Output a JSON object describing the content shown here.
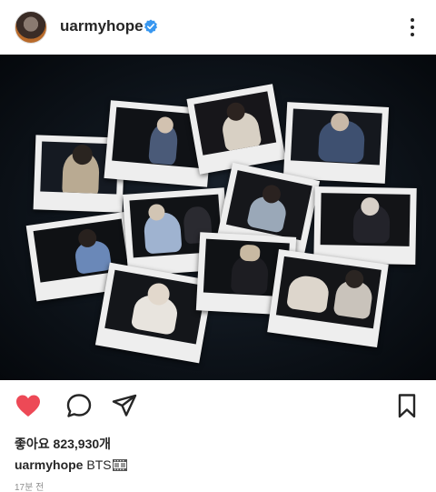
{
  "header": {
    "username": "uarmyhope",
    "avatar_alt": "profile avatar"
  },
  "colors": {
    "like_red": "#ed4956",
    "verified_blue": "#3897f0",
    "text": "#262626",
    "muted": "#8e8e8e"
  },
  "post": {
    "image_description_icon": "polaroid-photos-image",
    "likes_text": "좋아요 823,930개",
    "caption_user": "uarmyhope",
    "caption_text": "BTS",
    "caption_emoji": "film-frames-icon",
    "time_ago": "17분 전"
  },
  "actions": {
    "like_icon": "heart-icon",
    "liked": true,
    "comment_icon": "comment-icon",
    "share_icon": "send-icon",
    "save_icon": "bookmark-icon"
  }
}
